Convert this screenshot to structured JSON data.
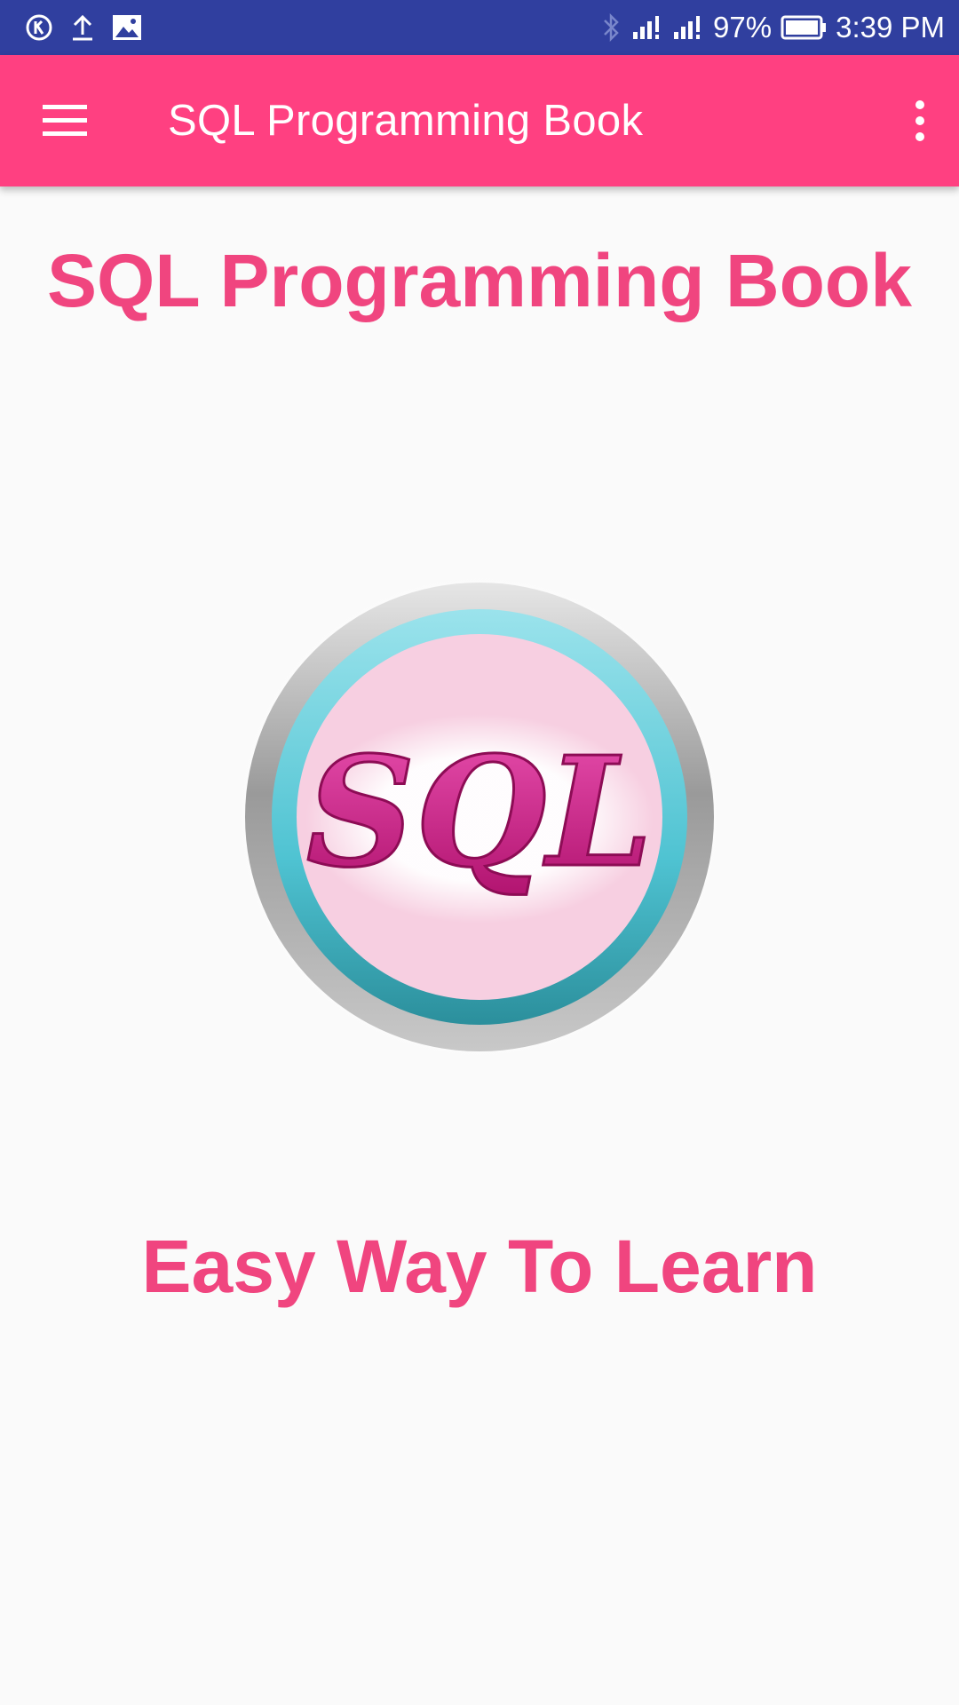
{
  "status_bar": {
    "battery_percent": "97%",
    "time": "3:39 PM",
    "left_icons": [
      "k-circle-icon",
      "upload-icon",
      "image-icon"
    ],
    "right_icons": [
      "bluetooth-icon",
      "signal-icon",
      "signal-icon",
      "battery-icon"
    ]
  },
  "app_bar": {
    "title": "SQL Programming Book",
    "menu_icon": "hamburger-menu-icon",
    "overflow_icon": "more-vert-icon"
  },
  "main": {
    "heading": "SQL Programming Book",
    "logo_text": "SQL",
    "tagline": "Easy Way To Learn"
  },
  "colors": {
    "status_bar": "#303f9f",
    "app_bar": "#ff4081",
    "accent_text": "#f0457f",
    "background": "#fafafa"
  }
}
